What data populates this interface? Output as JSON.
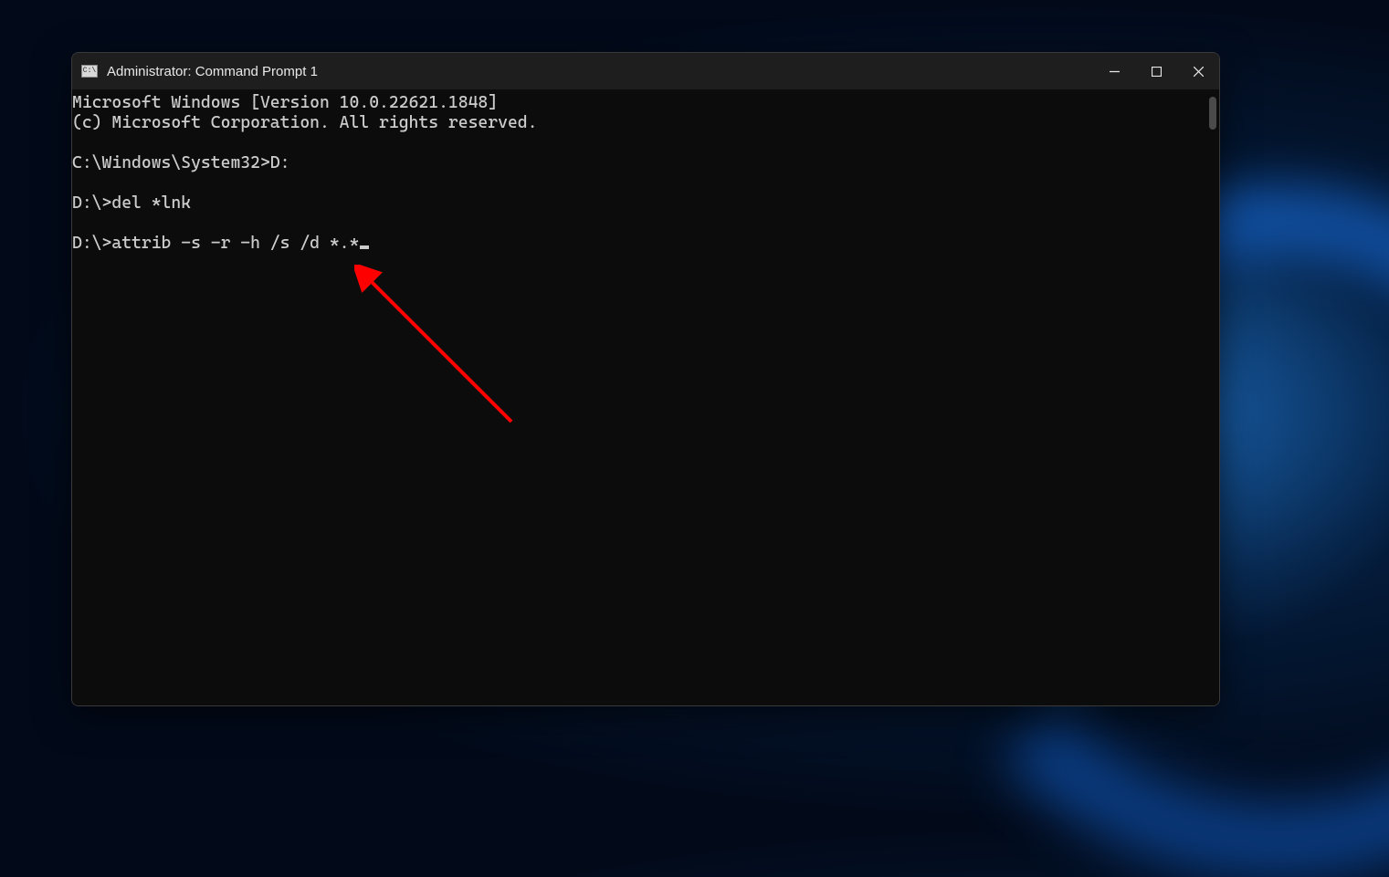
{
  "window": {
    "title": "Administrator: Command Prompt 1",
    "icon_label": "C:\\"
  },
  "terminal": {
    "lines": [
      "Microsoft Windows [Version 10.0.22621.1848]",
      "(c) Microsoft Corporation. All rights reserved.",
      "",
      "C:\\Windows\\System32>D:",
      "",
      "D:\\>del *lnk",
      "",
      "D:\\>attrib -s -r -h /s /d *.*"
    ]
  },
  "annotation": {
    "color": "#ff0000"
  }
}
